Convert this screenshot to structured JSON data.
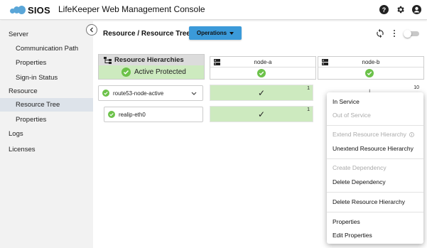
{
  "app": {
    "logo_text": "SIOS",
    "title": "LifeKeeper Web Management Console",
    "colors": {
      "brand_blue": "#5aa6d8",
      "ops_button": "#3b9ad9",
      "status_green": "#cdeabf",
      "check_green": "#6cc24a"
    }
  },
  "topbar_icons": [
    "help-icon",
    "gear-icon",
    "account-icon"
  ],
  "sidebar": {
    "items": [
      {
        "label": "Server"
      },
      {
        "label": "Communication Path"
      },
      {
        "label": "Properties"
      },
      {
        "label": "Sign-in Status"
      },
      {
        "label": "Resource"
      },
      {
        "label": "Resource Tree"
      },
      {
        "label": "Properties"
      },
      {
        "label": "Logs"
      },
      {
        "label": "Licenses"
      }
    ]
  },
  "main": {
    "breadcrumb": "Resource / Resource Tree",
    "operations_label": "Operations",
    "hierarchies_title": "Resource Hierarchies",
    "hierarchies_status": "Active Protected",
    "nodes": [
      {
        "name": "node-a"
      },
      {
        "name": "node-b"
      }
    ],
    "resources": [
      {
        "name": "route53-node-active",
        "node_a_priority": "1",
        "node_b_priority": "10"
      },
      {
        "name": "realip-eth0",
        "node_a_priority": "1"
      }
    ]
  },
  "context_menu": {
    "items": [
      {
        "label": "In Service",
        "enabled": true
      },
      {
        "label": "Out of Service",
        "enabled": false
      },
      {
        "label": "Extend Resource Hierarchy",
        "enabled": false
      },
      {
        "label": "Unextend Resource Hierarchy",
        "enabled": true
      },
      {
        "label": "Create Dependency",
        "enabled": false
      },
      {
        "label": "Delete Dependency",
        "enabled": true
      },
      {
        "label": "Delete Resource Hierarchy",
        "enabled": true
      },
      {
        "label": "Properties",
        "enabled": true
      },
      {
        "label": "Edit Properties",
        "enabled": true
      }
    ]
  }
}
